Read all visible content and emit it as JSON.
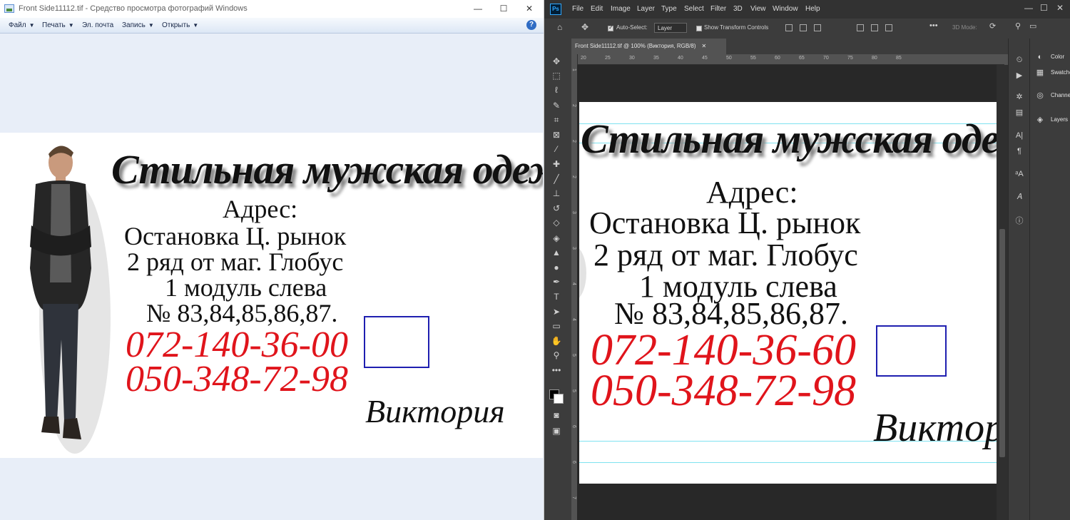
{
  "viewer": {
    "title": "Front Side11112.tif - Средство просмотра фотографий Windows",
    "menu": [
      "Файл",
      "Печать",
      "Эл. почта",
      "Запись",
      "Открыть"
    ],
    "help": "?",
    "window_controls": {
      "minimize": "—",
      "maximize": "☐",
      "close": "✕"
    }
  },
  "card": {
    "headline": "Стильная мужская одежда",
    "address_label": "Адрес:",
    "address_lines": [
      "Остановка Ц. рынок",
      "2 ряд от маг. Глобус",
      "1 модуль слева",
      "№ 83,84,85,86,87."
    ],
    "phone_viewer": "072-140-36-00",
    "phone_photoshop": "072-140-36-60",
    "phone2": "050-348-72-98",
    "name": "Виктория"
  },
  "photoshop": {
    "logo": "Ps",
    "menu": [
      "File",
      "Edit",
      "Image",
      "Layer",
      "Type",
      "Select",
      "Filter",
      "3D",
      "View",
      "Window",
      "Help"
    ],
    "window_controls": {
      "minimize": "—",
      "maximize": "☐",
      "close": "✕"
    },
    "options": {
      "auto_select": "Auto-Select:",
      "auto_select_target": "Layer",
      "transform_controls": "Show Transform Controls",
      "mode_3d": "3D Mode:"
    },
    "doc_tab": "Front Side11112.tif @ 100% (Виктория, RGB/8)",
    "ruler_top": [
      "20",
      "25",
      "30",
      "35",
      "40",
      "45",
      "50",
      "55",
      "60",
      "65",
      "70",
      "75",
      "80",
      "85"
    ],
    "ruler_left": [
      "1",
      "2",
      "2",
      "2",
      "3",
      "3",
      "4",
      "4",
      "5",
      "5",
      "6",
      "6",
      "7"
    ],
    "panels": [
      "Color",
      "Swatches",
      "Channels",
      "Layers"
    ]
  },
  "colors": {
    "phone_red": "#e0141b",
    "highlight_box": "#1f1fb0",
    "ps_accent": "#31a8ff"
  }
}
